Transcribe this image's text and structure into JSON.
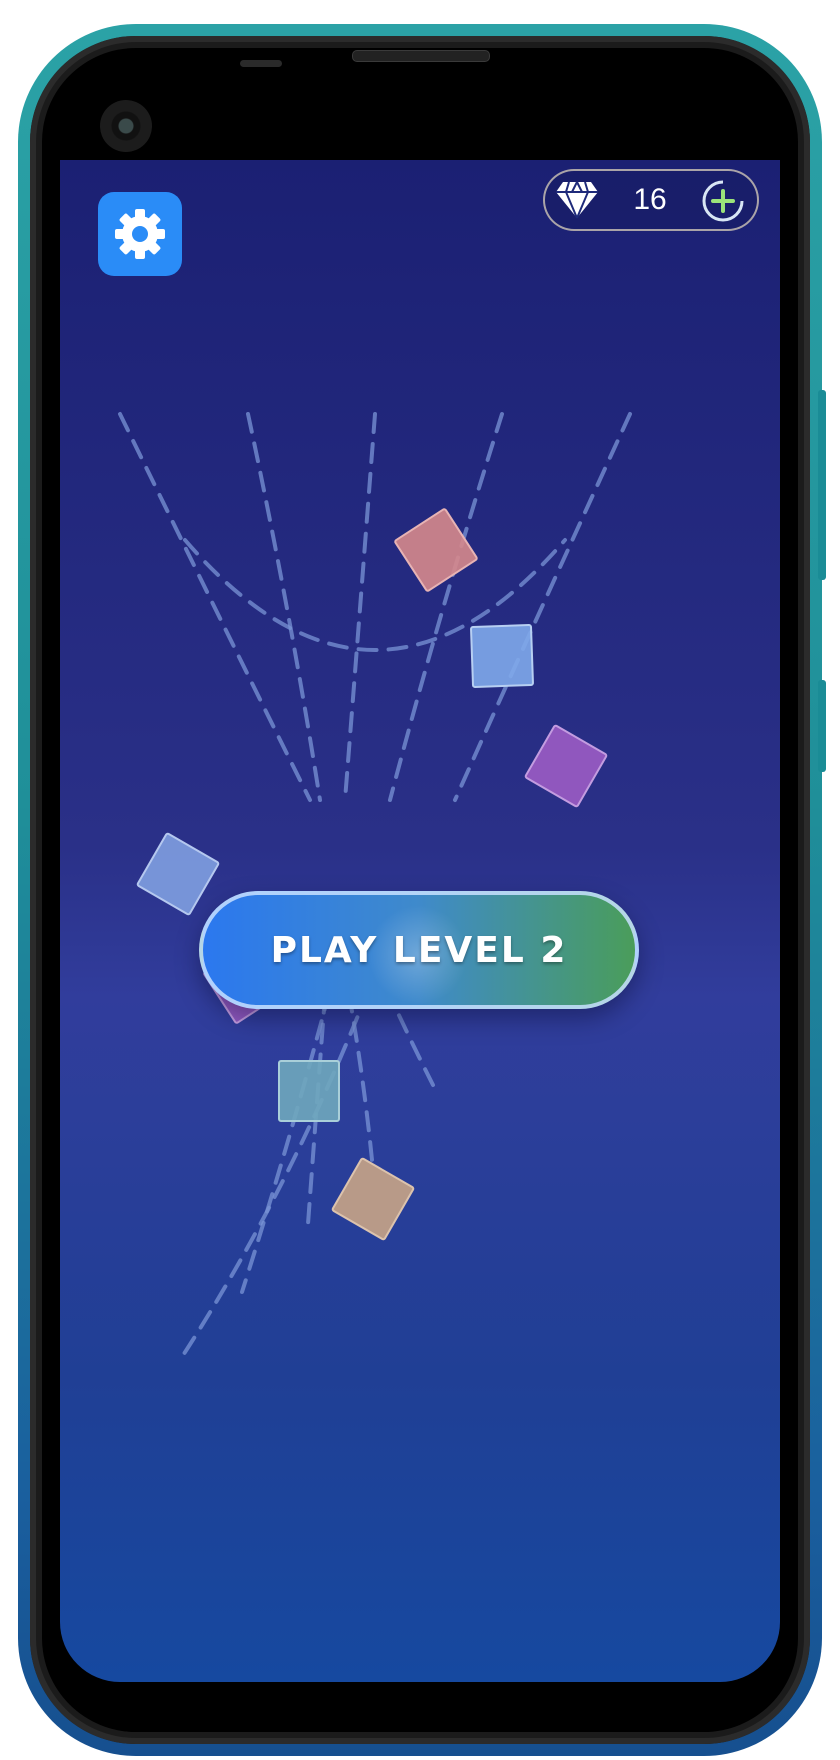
{
  "hud": {
    "settings_icon": "gear-icon",
    "gem_icon": "diamond-icon",
    "gem_count": "16",
    "add_gems_icon": "plus-circle-icon"
  },
  "play_button": {
    "label": "PLAY LEVEL 2"
  },
  "colors": {
    "settings_button": "#2a8cf7",
    "background_top": "#1b2073",
    "background_bottom": "#1649a0",
    "play_button_start": "#2b78ef",
    "play_button_end": "#4a9d5a",
    "dashed_path": "#7a94d6"
  },
  "blocks": [
    {
      "color": "#d6888c"
    },
    {
      "color": "#7fa9ea"
    },
    {
      "color": "#9b5cc4"
    },
    {
      "color": "#7f9fe0"
    },
    {
      "color": "#9b5cc4"
    },
    {
      "color": "#6fa7bc"
    },
    {
      "color": "#c4a287"
    }
  ]
}
